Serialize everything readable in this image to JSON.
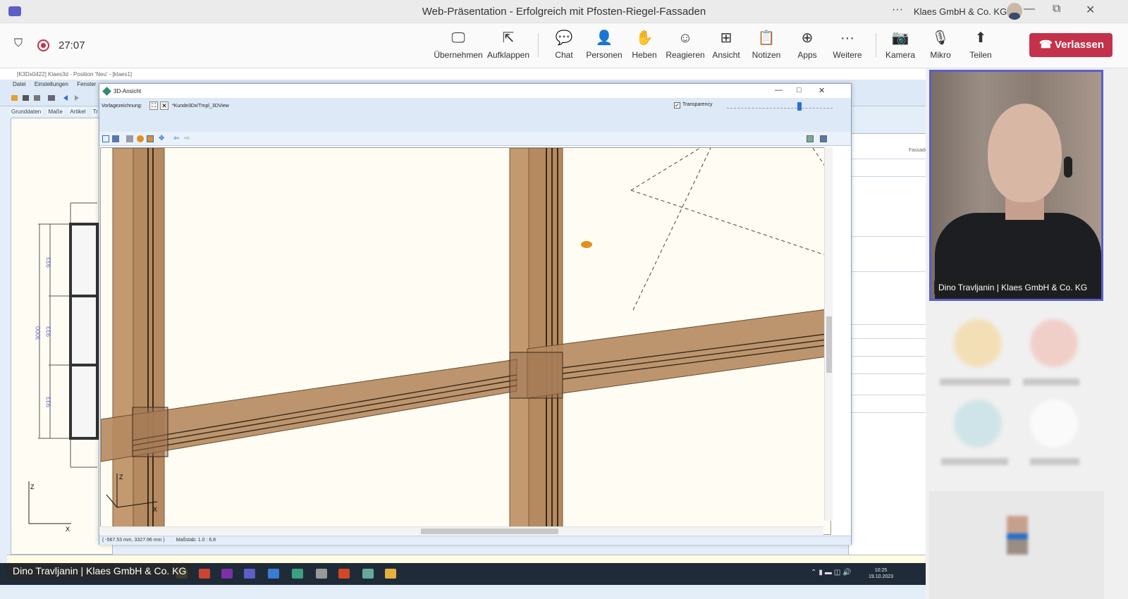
{
  "window": {
    "title": "Web-Präsentation - Erfolgreich mit Pfosten-Riegel-Fassaden",
    "org": "Klaes GmbH & Co. KG",
    "more": "···",
    "minimize": "—",
    "maximize": "⧉",
    "close": "✕"
  },
  "meeting": {
    "timer": "27:07"
  },
  "toolbar": {
    "items": [
      {
        "label": "Übernehmen",
        "icon": "🖵"
      },
      {
        "label": "Aufklappen",
        "icon": "⇱"
      },
      {
        "label": "Chat",
        "icon": "💬"
      },
      {
        "label": "Personen",
        "icon": "👤"
      },
      {
        "label": "Heben",
        "icon": "✋"
      },
      {
        "label": "Reagieren",
        "icon": "☺"
      },
      {
        "label": "Ansicht",
        "icon": "⊞"
      },
      {
        "label": "Notizen",
        "icon": "📋"
      },
      {
        "label": "Apps",
        "icon": "⊕"
      },
      {
        "label": "Weitere",
        "icon": "···"
      },
      {
        "label": "Kamera",
        "icon": "📷"
      },
      {
        "label": "Mikro",
        "icon": "🎙"
      },
      {
        "label": "Teilen",
        "icon": "⬆"
      }
    ],
    "leave_label": "Verlassen"
  },
  "k3d": {
    "title": "[K3Dx0422] Klaes3d - Position 'Neu' - [klaes1]",
    "menu": [
      "Datei",
      "Einstellungen",
      "Fenster"
    ],
    "tabs": [
      "Grunddaten",
      "Maße",
      "Artikel",
      "Tr"
    ],
    "dims": [
      "933",
      "933",
      "933",
      "3000"
    ],
    "fassade_label": "Fassade"
  },
  "dialog": {
    "title": "3D-Ansicht",
    "vorlage_label": "Vorlagezeichnung:",
    "vorlage_path": "*Kunde3Dx/Tmpl_3DView",
    "transparency_label": "Transparency",
    "transparency_checked": "✓",
    "status_coords": "( -567.53 mm, 3327.96 mm )",
    "status_scale": "Maßstab: 1.0 : 6.8"
  },
  "axes": {
    "z": "Z",
    "x": "X"
  },
  "taskbar": {
    "time": "10:25",
    "date": "19.10.2023"
  },
  "presenter_label": "Dino Travljanin | Klaes GmbH & Co. KG",
  "spotlight": {
    "name": "Dino Travljanin | Klaes GmbH & Co. KG"
  }
}
